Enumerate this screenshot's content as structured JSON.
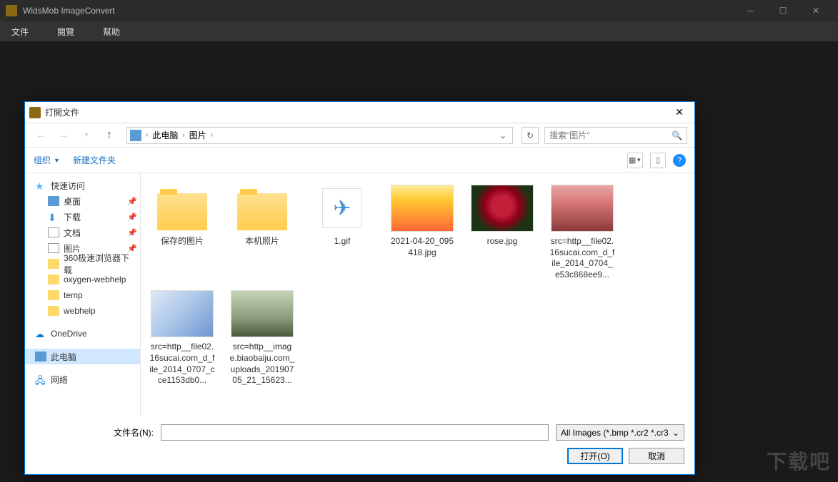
{
  "app": {
    "title": "WidsMob ImageConvert"
  },
  "menu": {
    "file": "文件",
    "view": "閱覽",
    "help": "幫助"
  },
  "dialog": {
    "title": "打開文件",
    "breadcrumb": {
      "root": "此电脑",
      "current": "图片"
    },
    "search": {
      "placeholder": "搜索\"图片\""
    },
    "toolbar": {
      "organize": "组织",
      "newfolder": "新建文件夹"
    },
    "filename_label": "文件名(N):",
    "filter": "All Images (*.bmp *.cr2 *.cr3",
    "open_btn": "打开(O)",
    "cancel_btn": "取消"
  },
  "sidebar": {
    "quick": "快速访问",
    "desktop": "桌面",
    "downloads": "下载",
    "documents": "文档",
    "pictures": "图片",
    "folder1": "360极速浏览器下载",
    "folder2": "oxygen-webhelp",
    "folder3": "temp",
    "folder4": "webhelp",
    "onedrive": "OneDrive",
    "thispc": "此电脑",
    "network": "网络"
  },
  "files": [
    {
      "name": "保存的图片",
      "type": "folder"
    },
    {
      "name": "本机照片",
      "type": "folder"
    },
    {
      "name": "1.gif",
      "type": "gif"
    },
    {
      "name": "2021-04-20_095418.jpg",
      "type": "img",
      "cls": "thumb-ad"
    },
    {
      "name": "rose.jpg",
      "type": "img",
      "cls": "thumb-rose"
    },
    {
      "name": "src=http__file02.16sucai.com_d_file_2014_0704_e53c868ee9...",
      "type": "img",
      "cls": "thumb-flower1"
    },
    {
      "name": "src=http__file02.16sucai.com_d_file_2014_0707_cce1153db0...",
      "type": "img",
      "cls": "thumb-flower2"
    },
    {
      "name": "src=http__image.biaobaiju.com_uploads_20190705_21_15623...",
      "type": "img",
      "cls": "thumb-hand"
    }
  ],
  "watermark": "下载吧"
}
